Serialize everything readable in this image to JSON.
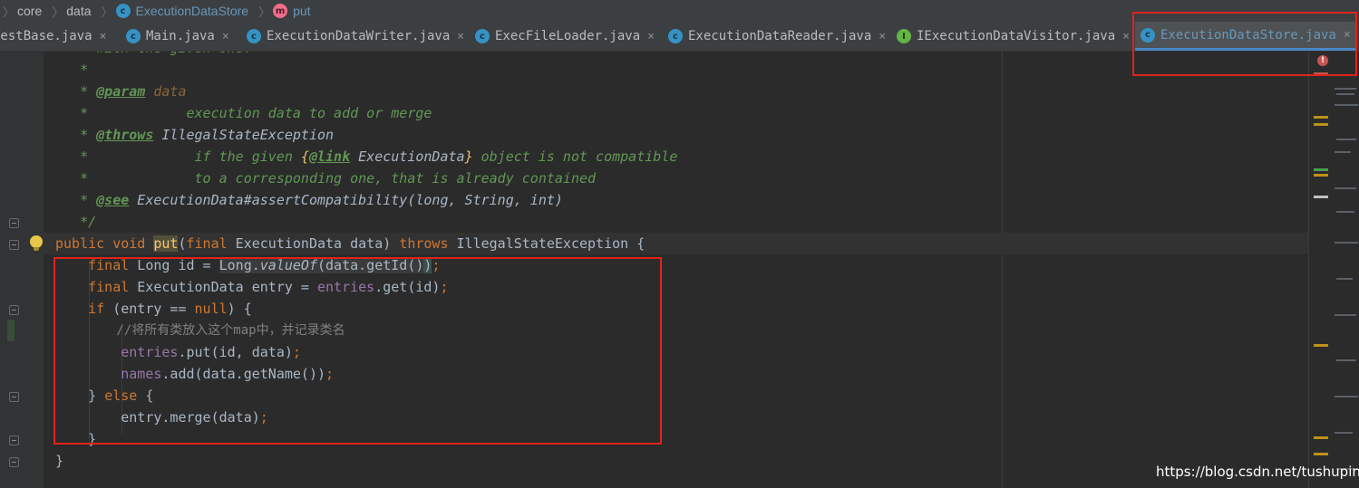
{
  "breadcrumb": {
    "items": [
      {
        "label": "core",
        "icon": ""
      },
      {
        "label": "data",
        "icon": ""
      },
      {
        "label": "ExecutionDataStore",
        "icon": "class-icon"
      },
      {
        "label": "put",
        "icon": "method-icon"
      }
    ],
    "class_icon_letter": "c",
    "method_icon_letter": "m"
  },
  "tabs": [
    {
      "label": "TestBase.java",
      "icon": "",
      "close": "×",
      "active": false
    },
    {
      "label": "Main.java",
      "icon": "c",
      "close": "×",
      "active": false
    },
    {
      "label": "ExecutionDataWriter.java",
      "icon": "c",
      "close": "×",
      "active": false
    },
    {
      "label": "ExecFileLoader.java",
      "icon": "c",
      "close": "×",
      "active": false
    },
    {
      "label": "ExecutionDataReader.java",
      "icon": "c",
      "close": "×",
      "active": false
    },
    {
      "label": "IExecutionDataVisitor.java",
      "icon": "I",
      "close": "×",
      "active": false
    },
    {
      "label": "ExecutionDataStore.java",
      "icon": "c",
      "close": "×",
      "active": true
    }
  ],
  "code": {
    "l0": "   * with the given one.",
    "l1": "   *",
    "l2_star": "   * ",
    "l2_tag": "@param",
    "l2_rest": " data",
    "l3": "   *            execution data to add or merge",
    "l4_star": "   * ",
    "l4_tag": "@throws",
    "l4_rest": " IllegalStateException",
    "l5_pre": "   *             if the given ",
    "l5_brace_open": "{",
    "l5_link": "@link",
    "l5_type": " ExecutionData",
    "l5_brace_close": "}",
    "l5_post": " object is not compatible",
    "l6": "   *             to a corresponding one, that is already contained",
    "l7_star": "   * ",
    "l7_tag": "@see",
    "l7_rest": " ExecutionData#assertCompatibility(long, String, int)",
    "l8": "   */",
    "l9_kw1": "public void ",
    "l9_fn": "put",
    "l9_p1": "(",
    "l9_kw2": "final",
    "l9_p2": " ExecutionData data) ",
    "l9_kw3": "throws",
    "l9_p3": " IllegalStateException {",
    "l10_kw": "    final",
    "l10_a": " Long id = ",
    "l10_b": "Long.",
    "l10_c": "valueOf",
    "l10_d": "(data.getId()",
    "l10_e": ")",
    "l10_f": ";",
    "l11_kw": "    final",
    "l11_a": " ExecutionData entry = ",
    "l11_field": "entries",
    "l11_b": ".get(id)",
    "l11_c": ";",
    "l12_kw": "    if",
    "l12_a": " (entry == ",
    "l12_null": "null",
    "l12_b": ") {",
    "l13": "        //将所有类放入这个map中，并记录类名",
    "l14_field": "        entries",
    "l14_a": ".put(id, data)",
    "l14_b": ";",
    "l15_field": "        names",
    "l15_a": ".add(data.getName())",
    "l15_b": ";",
    "l16_a": "    } ",
    "l16_kw": "else",
    "l16_b": " {",
    "l17_a": "        entry.merge(data)",
    "l17_b": ";",
    "l18": "    }",
    "l19": "}"
  },
  "gutter": {
    "bulb": "intention-bulb-icon",
    "error_mark": "!"
  },
  "watermark": "https://blog.csdn.net/tushuping",
  "colors": {
    "background": "#2b2b2b",
    "comment": "#629755",
    "keyword": "#cc7832",
    "function": "#ffc66d",
    "field": "#9876aa",
    "annotation_box": "#e0231b",
    "active_tab_underline": "#4a88c7"
  }
}
